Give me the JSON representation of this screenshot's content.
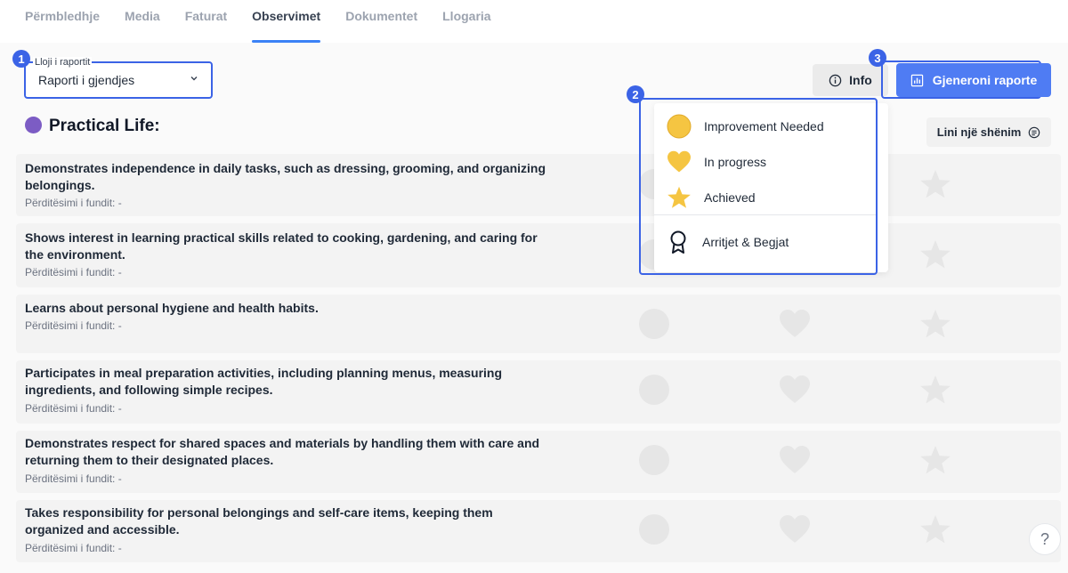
{
  "tabs": [
    "Përmbledhje",
    "Media",
    "Faturat",
    "Observimet",
    "Dokumentet",
    "Llogaria"
  ],
  "active_tab": "Observimet",
  "report_select": {
    "label": "Lloji i raportit",
    "value": "Raporti i gjendjes"
  },
  "badges": [
    "1",
    "2",
    "3"
  ],
  "buttons": {
    "info": "Info",
    "generate": "Gjeneroni raporte",
    "note": "Lini një shënim",
    "help": "?"
  },
  "section": {
    "title": "Practical Life:",
    "color": "#7c5cc4"
  },
  "legend": {
    "items": [
      {
        "icon": "yellow-circle-icon",
        "label": "Improvement Needed"
      },
      {
        "icon": "yellow-heart-icon",
        "label": "In progress"
      },
      {
        "icon": "star-icon",
        "label": "Achieved"
      },
      {
        "icon": "ribbon-icon",
        "label": "Arritjet & Begjat"
      }
    ]
  },
  "rows": [
    {
      "title": "Demonstrates independence in daily tasks, such as dressing, grooming, and organizing belongings.",
      "updated": "Përditësimi i fundit: -"
    },
    {
      "title": "Shows interest in learning practical skills related to cooking, gardening, and caring for the environment.",
      "updated": "Përditësimi i fundit: -"
    },
    {
      "title": "Learns about personal hygiene and health habits.",
      "updated": "Përditësimi i fundit: -"
    },
    {
      "title": "Participates in meal preparation activities, including planning menus, measuring ingredients, and following simple recipes.",
      "updated": "Përditësimi i fundit: -"
    },
    {
      "title": "Demonstrates respect for shared spaces and materials by handling them with care and returning them to their designated places.",
      "updated": "Përditësimi i fundit: -"
    },
    {
      "title": "Takes responsibility for personal belongings and self-care items, keeping them organized and accessible.",
      "updated": "Përditësimi i fundit: -"
    }
  ],
  "colors": {
    "accent": "#3b63e6",
    "button_primary": "#4f7cf3",
    "mark_gray": "#e6e6e6",
    "legend_yellow": "#f5c542"
  }
}
